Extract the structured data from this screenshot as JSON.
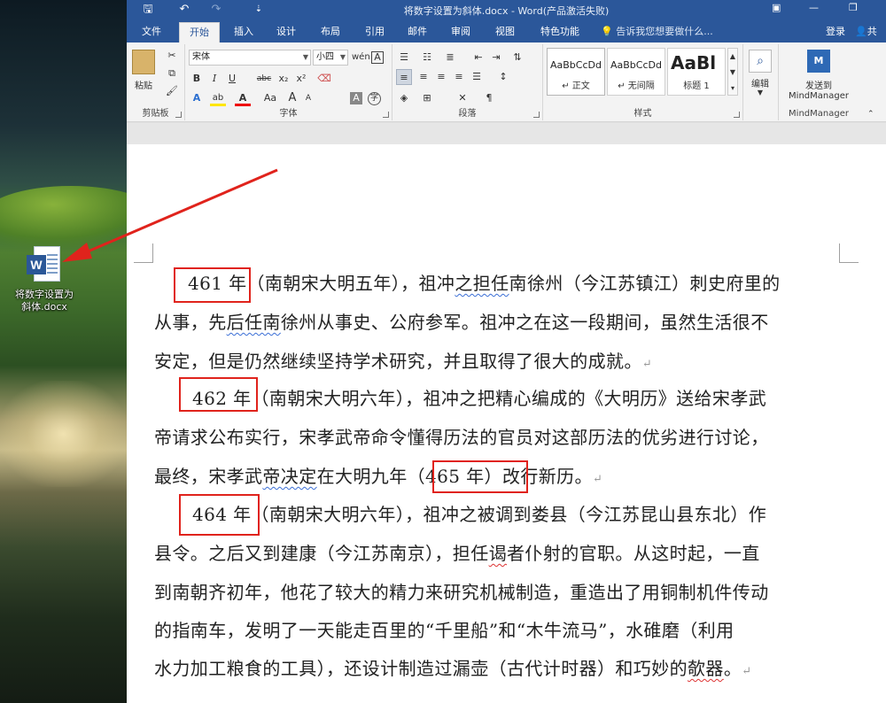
{
  "desktop": {
    "icon_label_line1": "将数字设置为",
    "icon_label_line2": "斜体.docx",
    "icon_letter": "W"
  },
  "titlebar": {
    "title": "将数字设置为斜体.docx - Word(产品激活失败)",
    "save_glyph": "🖫",
    "undo_glyph": "↶",
    "redo_glyph": "↷",
    "customize_glyph": "⇣"
  },
  "tabs": {
    "file": "文件",
    "home": "开始",
    "insert": "插入",
    "design": "设计",
    "layout": "布局",
    "references": "引用",
    "mailings": "邮件",
    "review": "审阅",
    "view": "视图",
    "special": "特色功能",
    "tell_me": "告诉我您想要做什么...",
    "signin": "登录",
    "share": "共"
  },
  "ribbon": {
    "clipboard": {
      "paste": "粘贴",
      "label": "剪贴板"
    },
    "font": {
      "font_name": "宋体",
      "font_size": "小四",
      "bold": "B",
      "italic": "I",
      "underline": "U",
      "strike": "abc",
      "subscript": "x₂",
      "superscript": "x²",
      "text_effect": "A",
      "highlight": "ab",
      "font_color": "A",
      "case": "Aa",
      "clear": "A",
      "shade": "A",
      "enclose": "字",
      "grow": "A",
      "shrink": "A",
      "phonetic": "wén",
      "border_char": "A",
      "label": "字体"
    },
    "paragraph": {
      "label": "段落"
    },
    "styles": {
      "items": [
        {
          "sample": "AaBbCcDd",
          "name": "↵ 正文"
        },
        {
          "sample": "AaBbCcDd",
          "name": "↵ 无间隔"
        },
        {
          "sample": "AaBl",
          "name": "标题 1"
        }
      ],
      "label": "样式"
    },
    "editing": {
      "label": "编辑"
    },
    "mindmanager": {
      "send_line1": "发送到",
      "send_line2": "MindManager",
      "label": "MindManager"
    }
  },
  "document": {
    "p1": {
      "l1_year": "461 年",
      "l1_rest_a": "（南朝宋大明五年），祖冲",
      "l1_squig": "之担任",
      "l1_rest_b": "南徐州（今江苏镇江）刺史府里的",
      "l2_a": "从事，先",
      "l2_squig": "后任南",
      "l2_b": "徐州从事史、公府参军。祖冲之在这一段期间，虽然生活很不",
      "l3": "安定，但是仍然继续坚持学术研究，并且取得了很大的成就。",
      "mark": "↵"
    },
    "p2": {
      "l1_year": "462 年",
      "l1_rest": "（南朝宋大明六年），祖冲之把精心编成的《大明历》送给宋孝武",
      "l2": "帝请求公布实行，宋孝武帝命令懂得历法的官员对这部历法的优劣进行讨论，",
      "l3_a": "最终，宋孝武",
      "l3_squig": "帝决定",
      "l3_b": "在大明九年",
      "l3_year": "（465 年）",
      "l3_c": "改行新历。",
      "mark": "↵"
    },
    "p3": {
      "l1_year": "464 年",
      "l1_rest": "（南朝宋大明六年），祖冲之被调到娄县（今江苏昆山县东北）作",
      "l2_a": "县令。之后又到建康（今江苏南京），担任",
      "l2_squig": "谒",
      "l2_b": "者仆射的官职。从这时起，一直",
      "l3": "到南朝齐初年，他花了较大的精力来研究机械制造，重造出了用铜制机件传动",
      "l4": "的指南车，发明了一天能走百里的“千里船”和“木牛流马”，水碓磨（利用",
      "l5_a": "水力加工粮食的工具），还设计制造过漏壶（古代计时器）和巧妙的",
      "l5_squig": "欹器",
      "l5_b": "。",
      "mark": "↵"
    }
  },
  "colors": {
    "word_blue": "#2b579a",
    "annotation_red": "#e0231c"
  }
}
